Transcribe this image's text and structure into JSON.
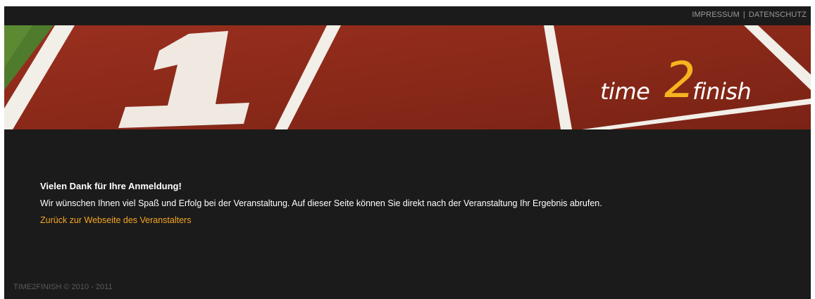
{
  "header": {
    "links": [
      {
        "label": "IMPRESSUM"
      },
      {
        "label": "DATENSCHUTZ"
      }
    ],
    "separator": "|"
  },
  "banner": {
    "logo": {
      "part1": "time",
      "accent": "2",
      "part2": "finish"
    },
    "colors": {
      "track": "#8e2a1c",
      "lines": "#f2eee8",
      "grass": "#4f7b2c",
      "accent": "#f6b41e"
    }
  },
  "main": {
    "heading": "Vielen Dank für Ihre Anmeldung!",
    "message": "Wir wünschen Ihnen viel Spaß und Erfolg bei der Veranstaltung. Auf dieser Seite können Sie direkt nach der Veranstaltung Ihr Ergebnis abrufen.",
    "back_link": "Zurück zur Webseite des Veranstalters"
  },
  "footer": {
    "copyright": "TIME2FINISH © 2010 - 2011"
  }
}
